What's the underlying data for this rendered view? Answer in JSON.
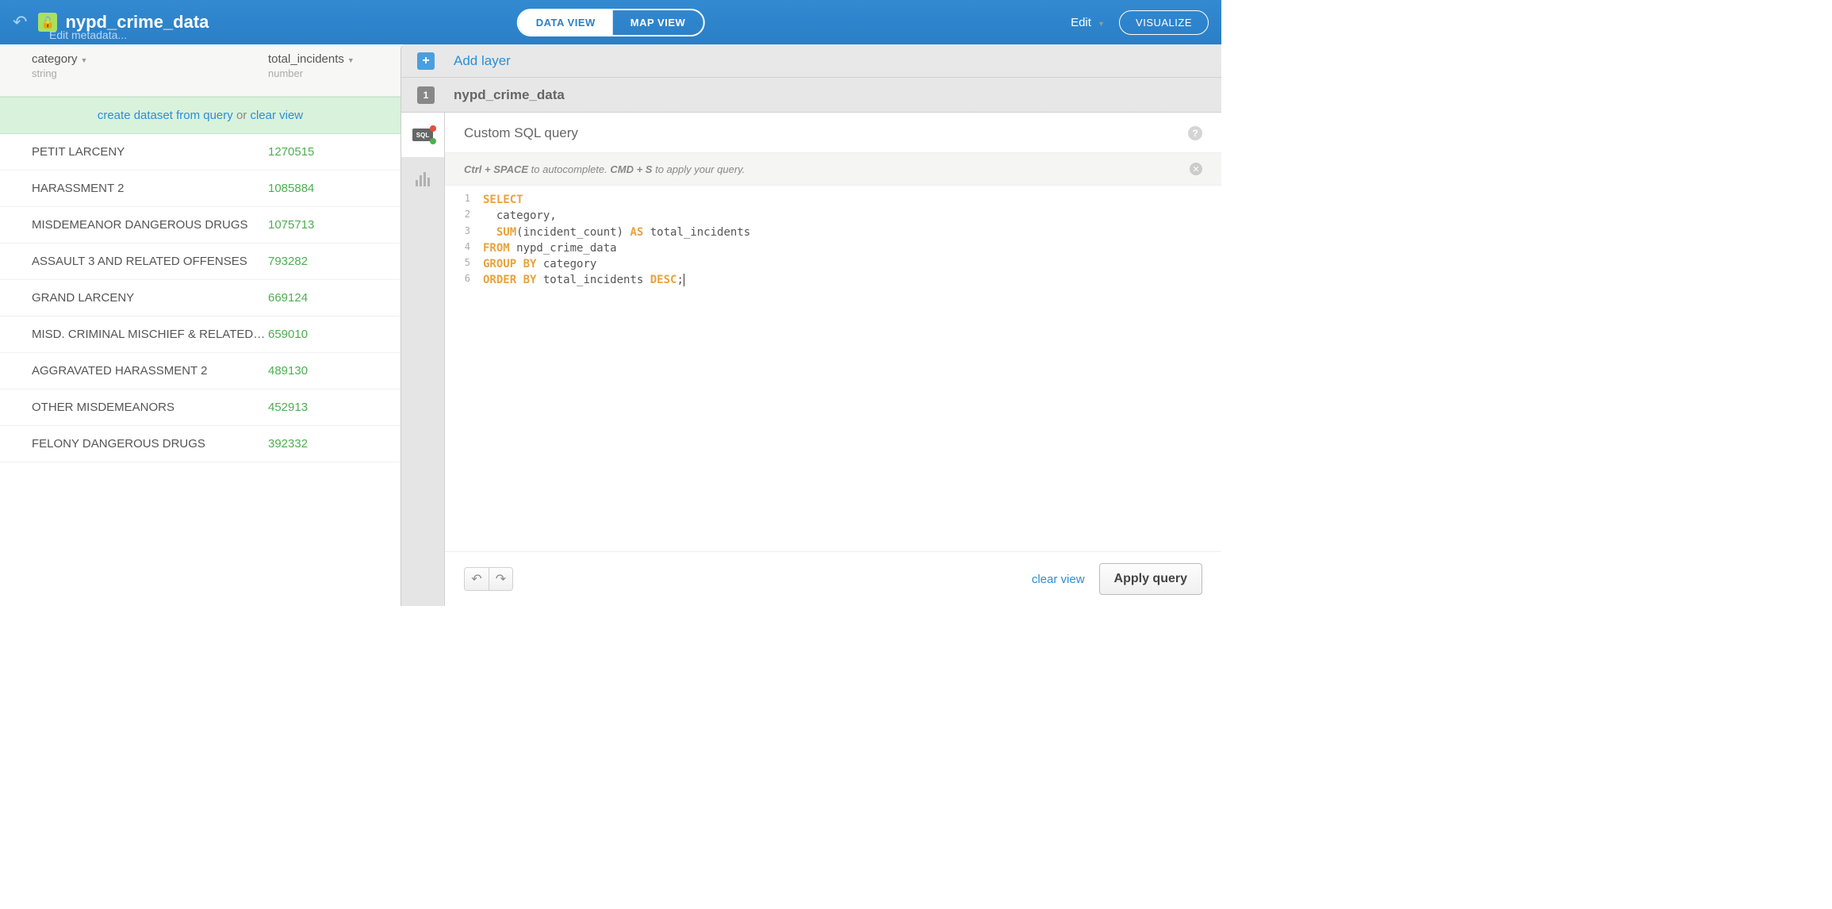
{
  "header": {
    "dataset_title": "nypd_crime_data",
    "edit_metadata": "Edit metadata...",
    "view_data": "DATA VIEW",
    "view_map": "MAP VIEW",
    "edit": "Edit",
    "visualize": "VISUALIZE"
  },
  "table": {
    "columns": [
      {
        "name": "category",
        "type": "string"
      },
      {
        "name": "total_incidents",
        "type": "number"
      }
    ],
    "banner": {
      "create": "create dataset from query",
      "or": "or",
      "clear": "clear view"
    },
    "rows": [
      {
        "category": "PETIT LARCENY",
        "total_incidents": "1270515"
      },
      {
        "category": "HARASSMENT 2",
        "total_incidents": "1085884"
      },
      {
        "category": "MISDEMEANOR DANGEROUS DRUGS",
        "total_incidents": "1075713"
      },
      {
        "category": "ASSAULT 3 AND RELATED OFFENSES",
        "total_incidents": "793282"
      },
      {
        "category": "GRAND LARCENY",
        "total_incidents": "669124"
      },
      {
        "category": "MISD. CRIMINAL MISCHIEF & RELATED OFFE...",
        "total_incidents": "659010"
      },
      {
        "category": "AGGRAVATED HARASSMENT 2",
        "total_incidents": "489130"
      },
      {
        "category": "OTHER MISDEMEANORS",
        "total_incidents": "452913"
      },
      {
        "category": "FELONY DANGEROUS DRUGS",
        "total_incidents": "392332"
      }
    ]
  },
  "sql_panel": {
    "add_layer": "Add layer",
    "layer_number": "1",
    "layer_name": "nypd_crime_data",
    "editor_title": "Custom SQL query",
    "hint_prefix": "Ctrl + SPACE",
    "hint_mid": " to autocomplete. ",
    "hint_bold2": "CMD + S",
    "hint_suffix": " to apply your query.",
    "code_lines": [
      [
        {
          "t": "kw",
          "v": "SELECT"
        }
      ],
      [
        {
          "t": "txt",
          "v": "  category,"
        }
      ],
      [
        {
          "t": "txt",
          "v": "  "
        },
        {
          "t": "fn",
          "v": "SUM"
        },
        {
          "t": "txt",
          "v": "(incident_count) "
        },
        {
          "t": "kw",
          "v": "AS"
        },
        {
          "t": "txt",
          "v": " total_incidents"
        }
      ],
      [
        {
          "t": "kw",
          "v": "FROM"
        },
        {
          "t": "txt",
          "v": " nypd_crime_data"
        }
      ],
      [
        {
          "t": "kw",
          "v": "GROUP"
        },
        {
          "t": "txt",
          "v": " "
        },
        {
          "t": "kw",
          "v": "BY"
        },
        {
          "t": "txt",
          "v": " category"
        }
      ],
      [
        {
          "t": "kw",
          "v": "ORDER"
        },
        {
          "t": "txt",
          "v": " "
        },
        {
          "t": "kw",
          "v": "BY"
        },
        {
          "t": "txt",
          "v": " total_incidents "
        },
        {
          "t": "kw",
          "v": "DESC"
        },
        {
          "t": "txt",
          "v": ";"
        }
      ]
    ],
    "clear_view": "clear view",
    "apply": "Apply query"
  }
}
